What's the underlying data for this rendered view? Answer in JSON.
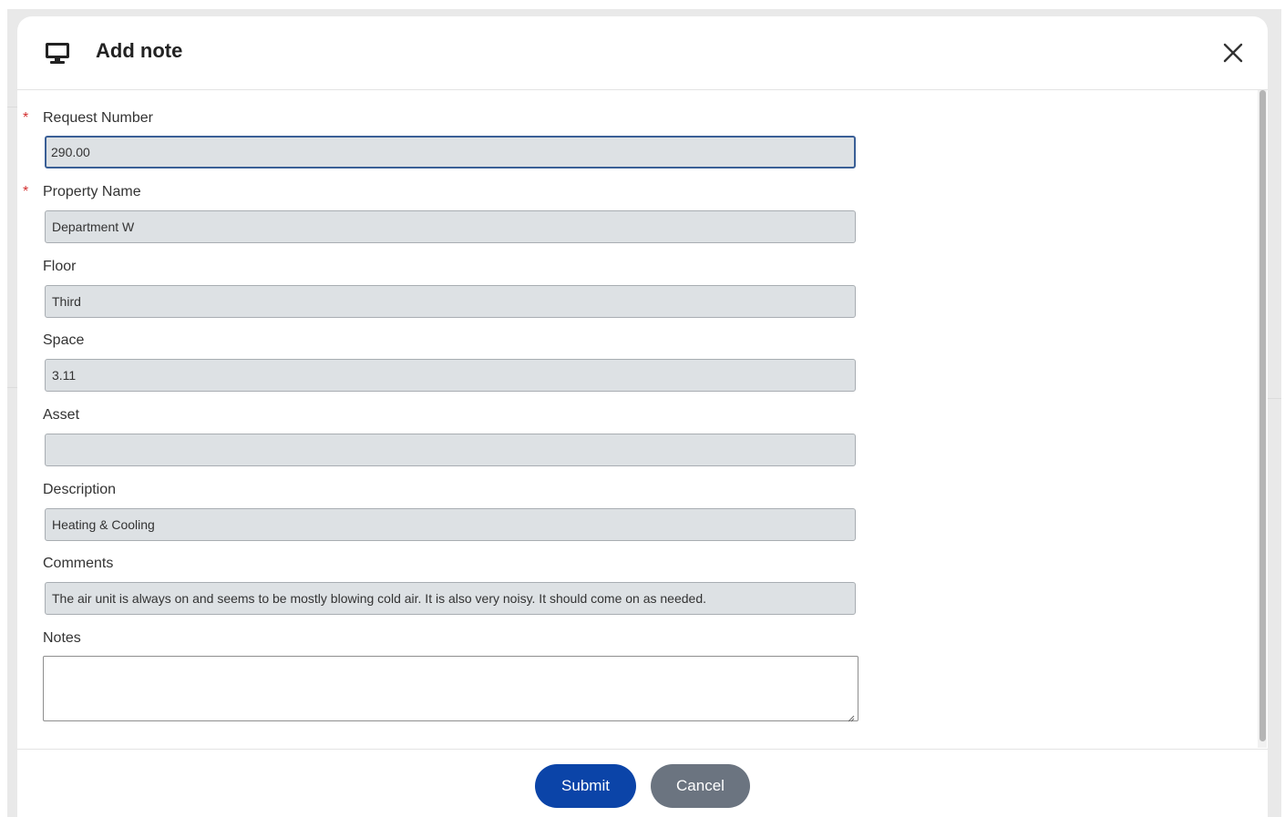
{
  "dialog": {
    "title": "Add note",
    "icon": "monitor-icon",
    "close_icon": "close-icon"
  },
  "fields": {
    "request_number": {
      "label": "Request Number",
      "required": true,
      "value": "290.00"
    },
    "property_name": {
      "label": "Property Name",
      "required": true,
      "value": "Department W"
    },
    "floor": {
      "label": "Floor",
      "required": false,
      "value": "Third"
    },
    "space": {
      "label": "Space",
      "required": false,
      "value": "3.11"
    },
    "asset": {
      "label": "Asset",
      "required": false,
      "value": ""
    },
    "description": {
      "label": "Description",
      "required": false,
      "value": "Heating & Cooling"
    },
    "comments": {
      "label": "Comments",
      "required": false,
      "value": "The air unit is always on and seems to be mostly blowing cold air. It is also very noisy. It should come on as needed."
    },
    "notes": {
      "label": "Notes",
      "required": false,
      "value": ""
    }
  },
  "required_marker": "*",
  "footer": {
    "submit_label": "Submit",
    "cancel_label": "Cancel"
  },
  "colors": {
    "primary": "#0b44a8",
    "secondary": "#6b7480",
    "required": "#d32f2f",
    "readonly_field_bg": "#dde1e4",
    "focus_border": "#3a5f96"
  }
}
